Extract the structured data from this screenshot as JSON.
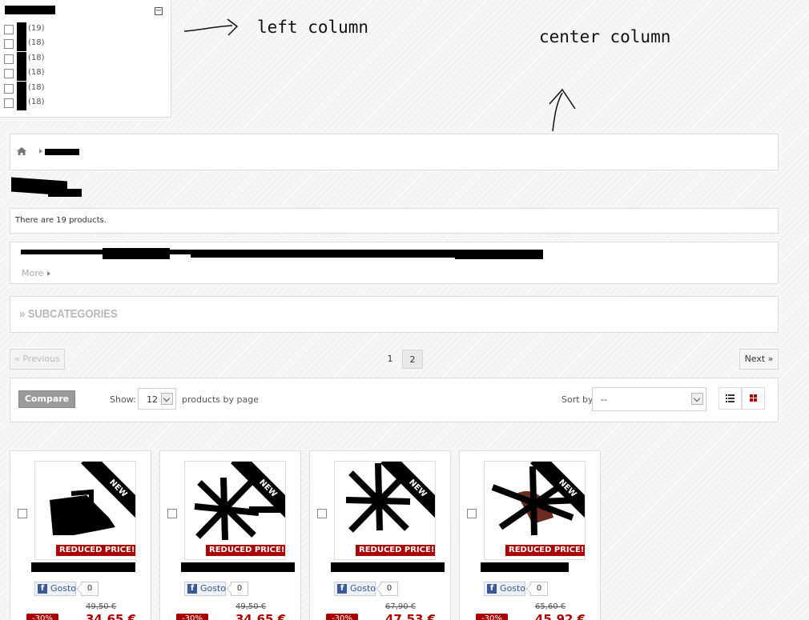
{
  "filter": {
    "counts": [
      "(19)",
      "(18)",
      "(18)",
      "(18)",
      "(18)",
      "(18)"
    ],
    "collapse_symbol": "−"
  },
  "annotations": {
    "left_column": "left column",
    "center_column": "center column"
  },
  "breadcrumb": {
    "home_icon": "home-icon"
  },
  "product_count": "There are 19 products.",
  "description": {
    "more_label": "More"
  },
  "subcategories": {
    "title": "» SUBCATEGORIES"
  },
  "pagination": {
    "previous_label": "« Previous",
    "next_label": "Next »",
    "pages": [
      "1",
      "2"
    ],
    "current_page": "2"
  },
  "toolbar": {
    "compare_label": "Compare",
    "show_label": "Show:",
    "per_page_value": "12",
    "per_page_suffix": "products by page",
    "sort_label": "Sort by",
    "sort_value": "--",
    "view_list_icon": "list-view-icon",
    "view_grid_icon": "grid-view-icon"
  },
  "products": [
    {
      "badge": "NEW",
      "reduced_label": "REDUCED PRICE!",
      "like_label": "Gosto",
      "like_count": "0",
      "old_price": "49,50 €",
      "new_price": "34,65 €",
      "discount": "-30%"
    },
    {
      "badge": "NEW",
      "reduced_label": "REDUCED PRICE!",
      "like_label": "Gosto",
      "like_count": "0",
      "old_price": "49,50 €",
      "new_price": "34,65 €",
      "discount": "-30%"
    },
    {
      "badge": "NEW",
      "reduced_label": "REDUCED PRICE!",
      "like_label": "Gosto",
      "like_count": "0",
      "old_price": "67,90 €",
      "new_price": "47,53 €",
      "discount": "-30%"
    },
    {
      "badge": "NEW",
      "reduced_label": "REDUCED PRICE!",
      "like_label": "Gosto",
      "like_count": "0",
      "old_price": "65,60 €",
      "new_price": "45,92 €",
      "discount": "-30%"
    }
  ],
  "colors": {
    "accent_red": "#a80000",
    "facebook_blue": "#3b5998"
  }
}
